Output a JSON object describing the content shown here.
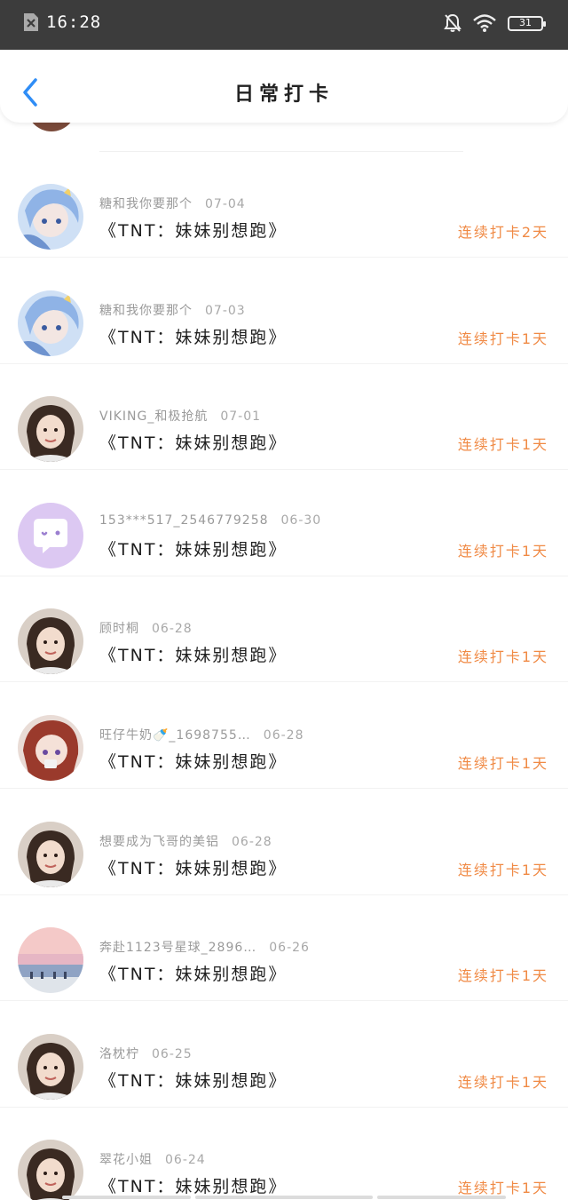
{
  "status_bar": {
    "time": "16:28",
    "battery": "31"
  },
  "header": {
    "title": "日常打卡",
    "back_icon": "chevron-left-icon"
  },
  "colors": {
    "accent": "#2f8df6",
    "streak": "#f08a45"
  },
  "items": [
    {
      "username": "糖和我你要那个",
      "date": "07-04",
      "book": "《TNT：妹妹别想跑》",
      "streak": "连续打卡2天",
      "avatar": "anime-blue-hair-avatar"
    },
    {
      "username": "糖和我你要那个",
      "date": "07-03",
      "book": "《TNT：妹妹别想跑》",
      "streak": "连续打卡1天",
      "avatar": "anime-blue-hair-avatar"
    },
    {
      "username": "VIKING_和极抢航",
      "date": "07-01",
      "book": "《TNT：妹妹别想跑》",
      "streak": "连续打卡1天",
      "avatar": "photo-avatar"
    },
    {
      "username": "153***517_2546779258",
      "date": "06-30",
      "book": "《TNT：妹妹别想跑》",
      "streak": "连续打卡1天",
      "avatar": "default-chat-avatar"
    },
    {
      "username": "顾时桐",
      "date": "06-28",
      "book": "《TNT：妹妹别想跑》",
      "streak": "连续打卡1天",
      "avatar": "photo-avatar"
    },
    {
      "username": "旺仔牛奶🍼_1698755…",
      "date": "06-28",
      "book": "《TNT：妹妹别想跑》",
      "streak": "连续打卡1天",
      "avatar": "anime-red-hair-avatar"
    },
    {
      "username": "想要成为飞哥的美铝",
      "date": "06-28",
      "book": "《TNT：妹妹别想跑》",
      "streak": "连续打卡1天",
      "avatar": "photo-avatar"
    },
    {
      "username": "奔赴1123号星球_2896…",
      "date": "06-26",
      "book": "《TNT：妹妹别想跑》",
      "streak": "连续打卡1天",
      "avatar": "sunset-beach-avatar"
    },
    {
      "username": "洛枕柠",
      "date": "06-25",
      "book": "《TNT：妹妹别想跑》",
      "streak": "连续打卡1天",
      "avatar": "photo-avatar"
    },
    {
      "username": "翠花小姐",
      "date": "06-24",
      "book": "《TNT：妹妹别想跑》",
      "streak": "连续打卡1天",
      "avatar": "photo-avatar"
    }
  ]
}
